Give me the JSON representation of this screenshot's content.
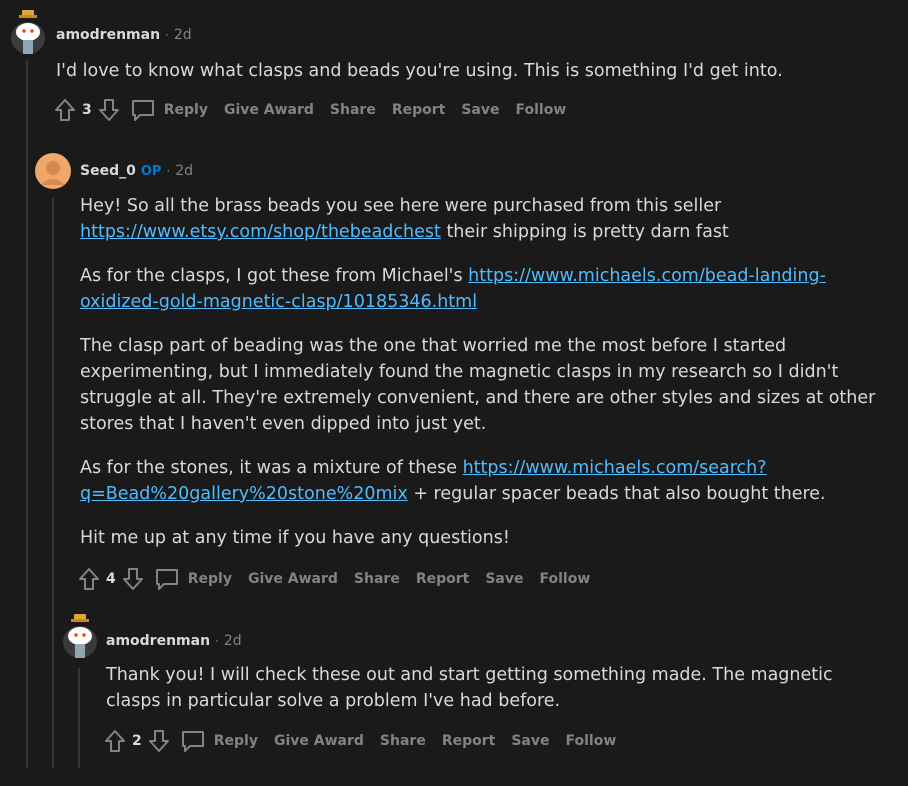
{
  "comments": [
    {
      "author": "amodrenman",
      "op": "",
      "time": "2d",
      "paragraphs": [
        [
          {
            "t": "I'd love to know what clasps and beads you're using. This is something I'd get into."
          }
        ]
      ],
      "score": "3",
      "avatar_bg": "#2a2a2a"
    },
    {
      "author": "Seed_0",
      "op": "OP",
      "time": "2d",
      "paragraphs": [
        [
          {
            "t": "Hey! So all the brass beads you see here were purchased from this seller "
          },
          {
            "t": "https://www.etsy.com/shop/thebeadchest",
            "link": true
          },
          {
            "t": " their shipping is pretty darn fast"
          }
        ],
        [
          {
            "t": "As for the clasps, I got these from Michael's "
          },
          {
            "t": "https://www.michaels.com/bead-landing-oxidized-gold-magnetic-clasp/10185346.html",
            "link": true
          }
        ],
        [
          {
            "t": "The clasp part of beading was the one that worried me the most before I started experimenting, but I immediately found the magnetic clasps in my research so I didn't struggle at all. They're extremely convenient, and there are other styles and sizes at other stores that I haven't even dipped into just yet."
          }
        ],
        [
          {
            "t": "As for the stones, it was a mixture of these "
          },
          {
            "t": "https://www.michaels.com/search?q=Bead%20gallery%20stone%20mix",
            "link": true
          },
          {
            "t": " + regular spacer beads that also bought there."
          }
        ],
        [
          {
            "t": "Hit me up at any time if you have any questions!"
          }
        ]
      ],
      "score": "4",
      "avatar_bg": "#f0a76a"
    },
    {
      "author": "amodrenman",
      "op": "",
      "time": "2d",
      "paragraphs": [
        [
          {
            "t": "Thank you! I will check these out and start getting something made. The magnetic clasps in particular solve a problem I've had before."
          }
        ]
      ],
      "score": "2",
      "avatar_bg": "#2a2a2a"
    }
  ],
  "actions": {
    "reply": "Reply",
    "give_award": "Give Award",
    "share": "Share",
    "report": "Report",
    "save": "Save",
    "follow": "Follow"
  },
  "dot": "·",
  "colors": {
    "background": "#1a1a1b",
    "link": "#4fbcff",
    "op": "#0079d3",
    "muted": "#818384",
    "text": "#d7dadc"
  }
}
